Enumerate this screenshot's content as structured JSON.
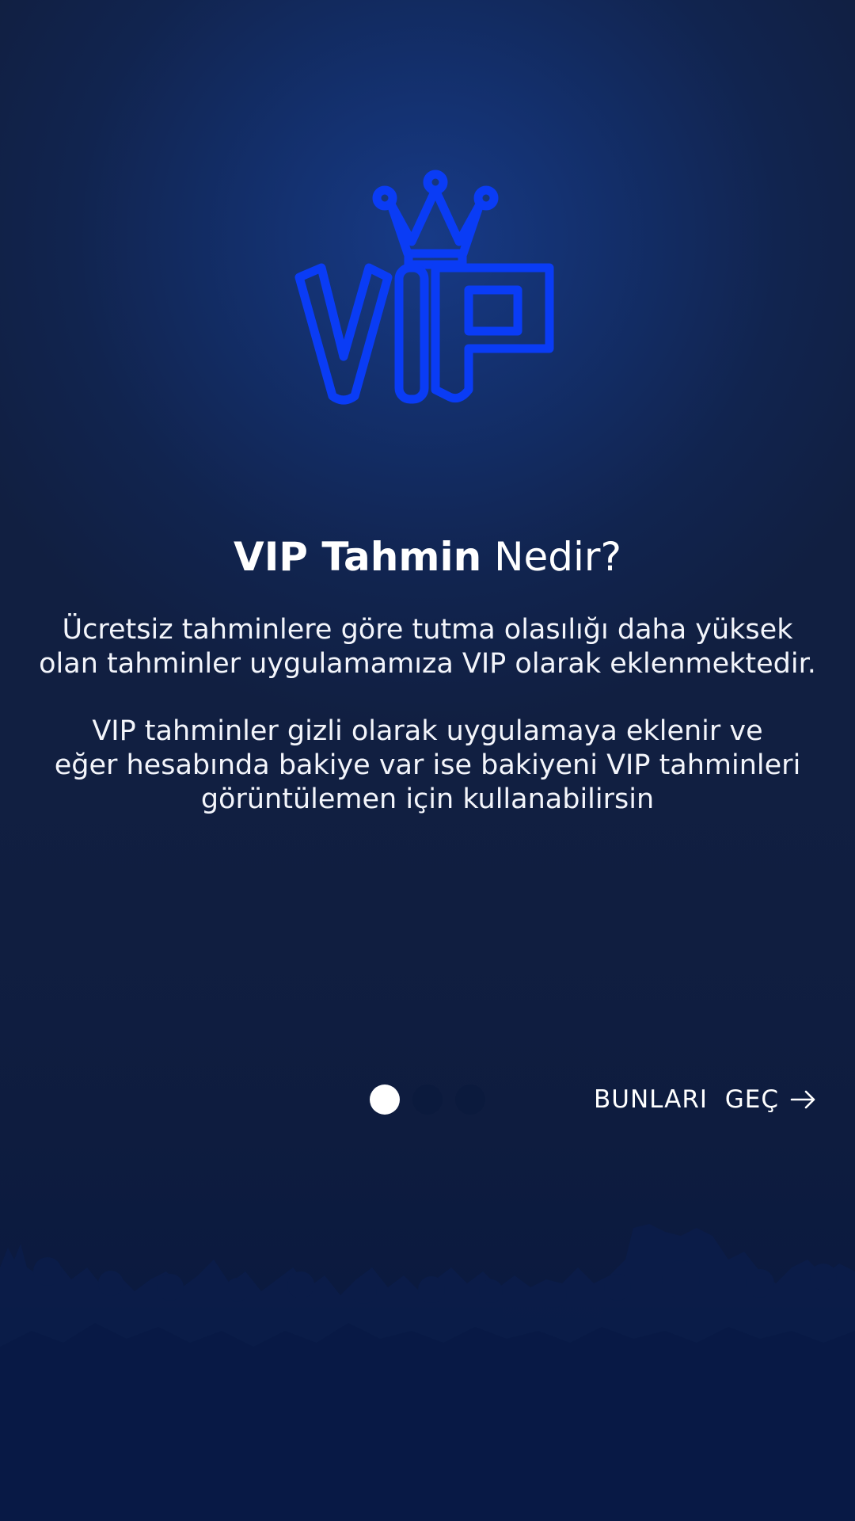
{
  "colors": {
    "background": "#111f41",
    "glow": "#173a86",
    "logo_blue": "#0a3cf5",
    "dot_inactive": "#0b1a3d",
    "dot_active": "#ffffff",
    "crowd": "#0b1d4a"
  },
  "logo": {
    "text": "VIP",
    "icon": "crown-icon"
  },
  "heading": {
    "strong": "VIP Tahmin",
    "light": "Nedir?"
  },
  "paragraph1": {
    "line1": "Ücretsiz tahminlere göre tutma olasılığı daha yüksek",
    "line2": "olan tahminler uygulamamıza VIP olarak eklenmektedir."
  },
  "paragraph2": {
    "line1": "VIP tahminler gizli olarak uygulamaya eklenir ve",
    "line2": "eğer hesabında bakiye var ise bakiyeni VIP tahminleri",
    "line3": "görüntülemen için kullanabilirsin"
  },
  "pager": {
    "total": 3,
    "current": 1
  },
  "skip": {
    "label": "BUNLARI  GEÇ",
    "icon": "arrow-right-icon"
  }
}
